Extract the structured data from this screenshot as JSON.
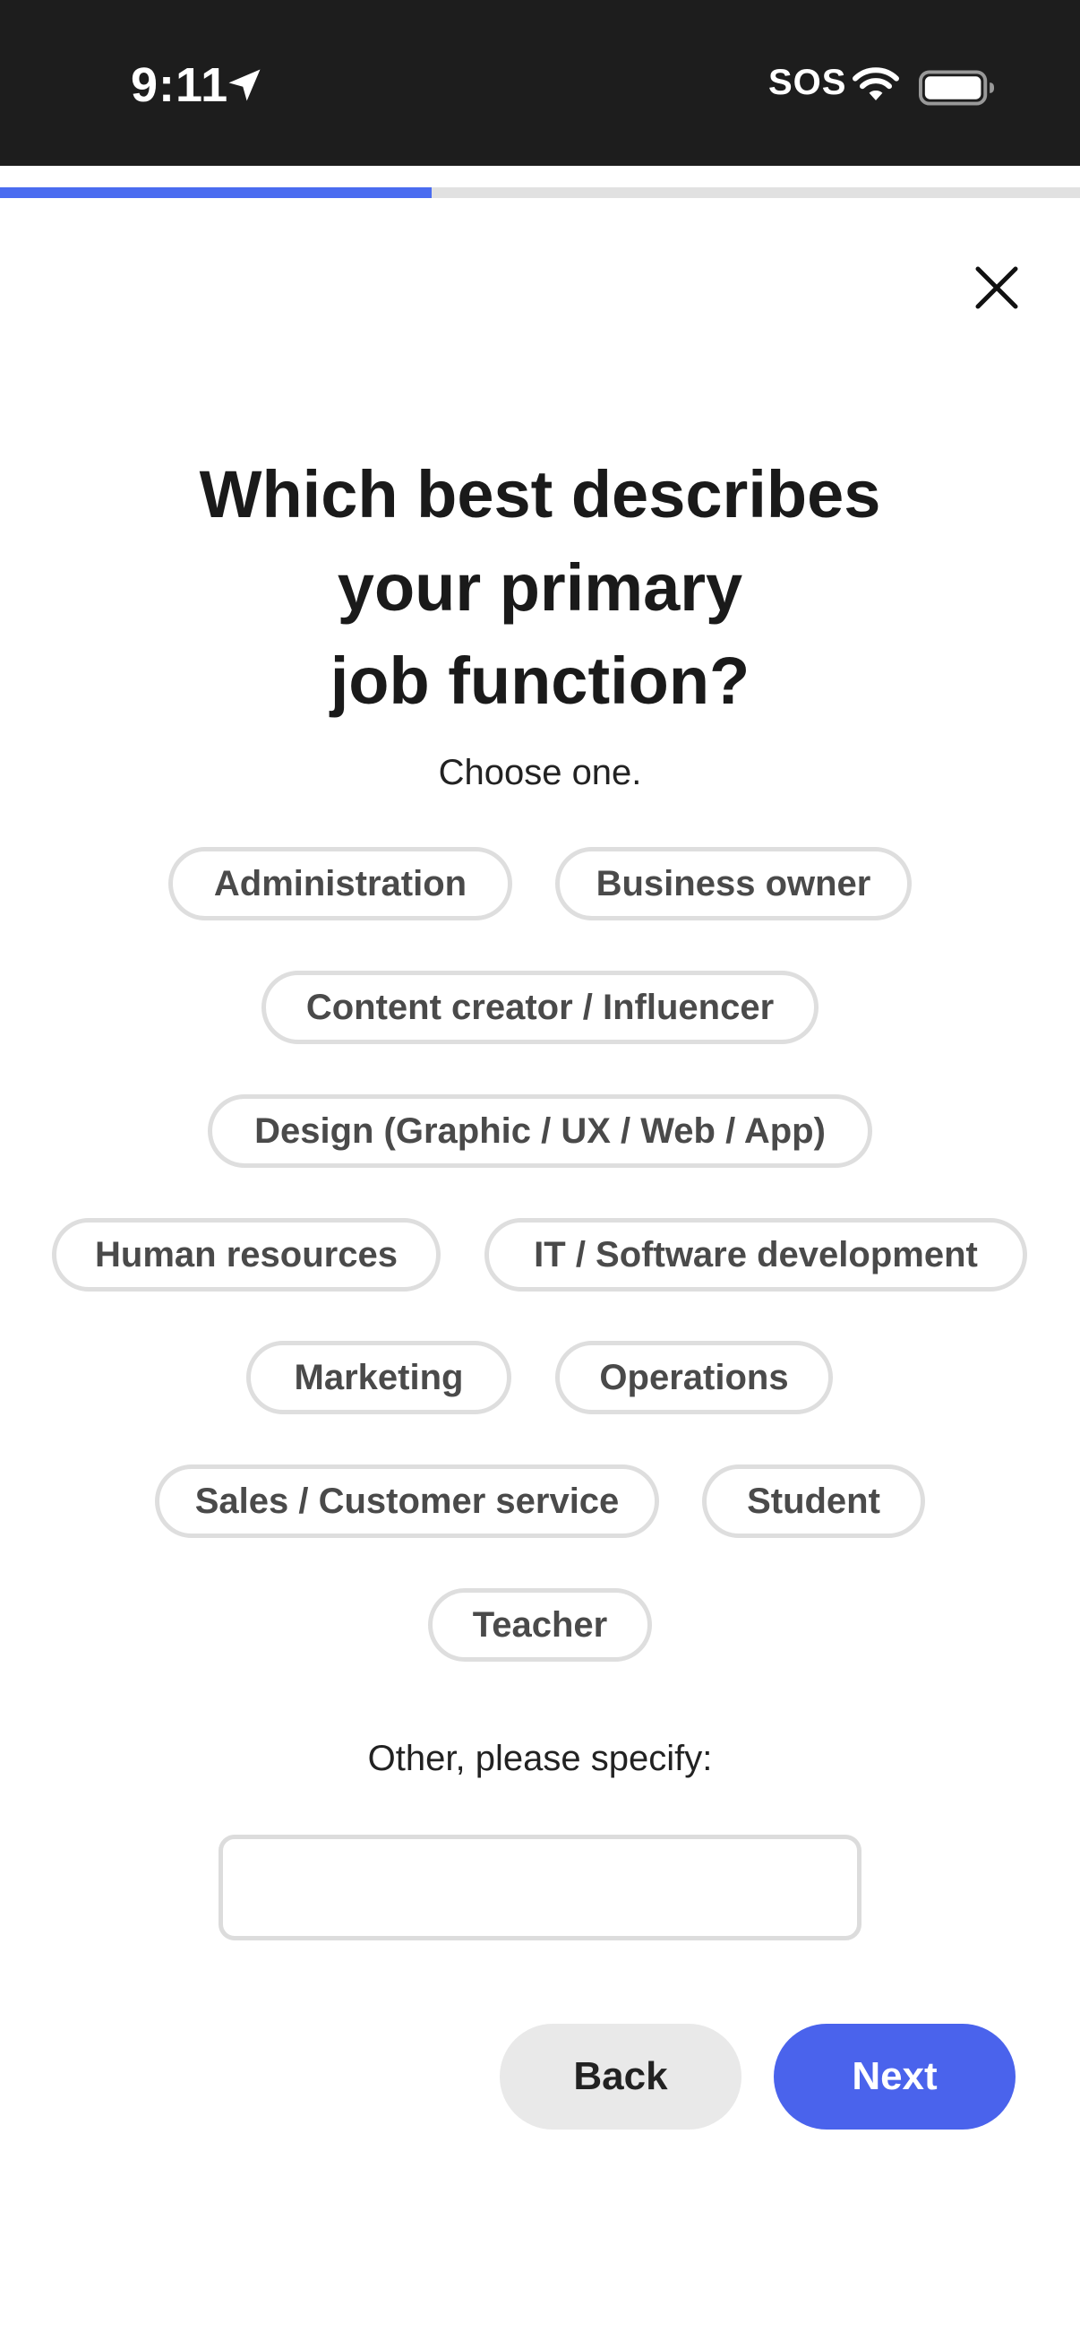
{
  "status_bar": {
    "time": "9:11",
    "carrier": "SOS",
    "icons": [
      "location-arrow-icon",
      "wifi-icon",
      "battery-icon"
    ]
  },
  "progress": {
    "fraction": 0.4
  },
  "close_icon": "close-icon",
  "question": {
    "title_line1": "Which best describes",
    "title_line2": "your primary",
    "title_line3": "job function?",
    "subtitle": "Choose one."
  },
  "options": [
    "Administration",
    "Business owner",
    "Content creator / Influencer",
    "Design (Graphic / UX / Web / App)",
    "Human resources",
    "IT / Software development",
    "Marketing",
    "Operations",
    "Sales / Customer service",
    "Student",
    "Teacher"
  ],
  "other": {
    "label": "Other, please specify:",
    "value": "",
    "placeholder": ""
  },
  "actions": {
    "back_label": "Back",
    "next_label": "Next"
  },
  "colors": {
    "accent": "#4a63ec",
    "progress": "#4a6cf0",
    "chip_border": "#dedede",
    "status_bar": "#1d1d1d"
  }
}
